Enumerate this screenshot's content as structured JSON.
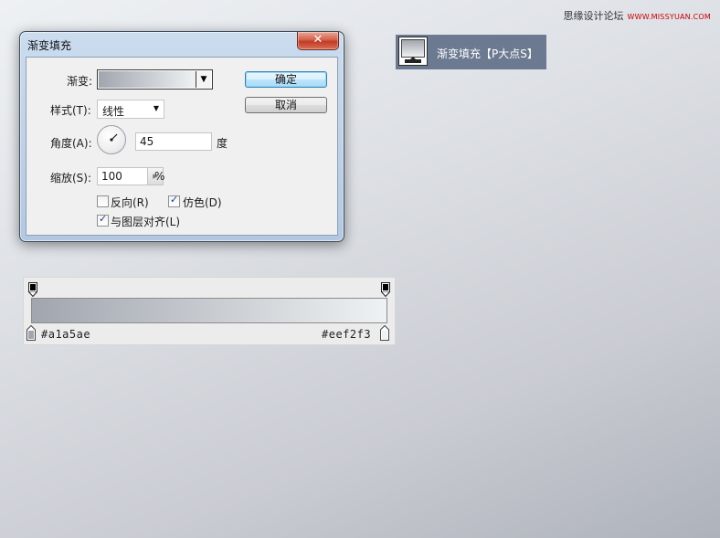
{
  "watermark": {
    "site_name": "思缘设计论坛",
    "url": "WWW.MISSYUAN.COM"
  },
  "dialog": {
    "title": "渐变填充",
    "close_symbol": "✕",
    "labels": {
      "gradient": "渐变:",
      "style": "样式(T):",
      "angle": "角度(A):",
      "scale": "缩放(S):"
    },
    "style_value": "线性",
    "angle_value": "45",
    "angle_unit": "度",
    "scale_value": "100",
    "scale_unit": "%",
    "checkboxes": {
      "reverse": {
        "label": "反向(R)",
        "checked": false
      },
      "dither": {
        "label": "仿色(D)",
        "checked": true
      },
      "align_layer": {
        "label": "与图层对齐(L)",
        "checked": true
      }
    },
    "buttons": {
      "ok": "确定",
      "cancel": "取消"
    },
    "gradient_colors": [
      "#a1a5ae",
      "#eef2f3"
    ]
  },
  "layer": {
    "name": "渐变填充【P大点S】",
    "icon": "gradient-fill-layer-icon"
  },
  "gradient_editor": {
    "start_color": "#a1a5ae",
    "end_color": "#eef2f3"
  },
  "colors": {
    "layer_bg": "#6b7a90",
    "default_button": "#bee6fd",
    "close_button": "#c23a22"
  }
}
